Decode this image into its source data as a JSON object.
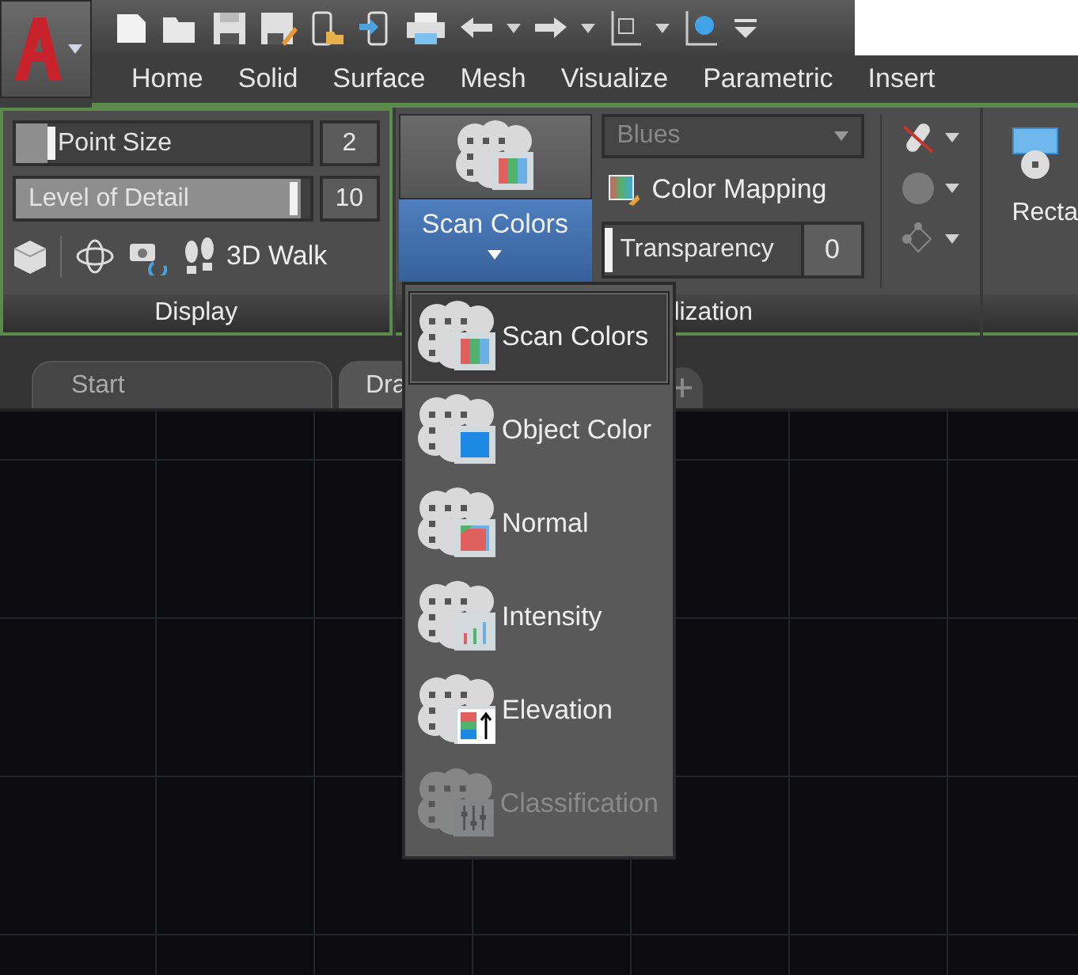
{
  "ribbon_tabs": [
    {
      "label": "Home",
      "selected": false
    },
    {
      "label": "Solid",
      "selected": false
    },
    {
      "label": "Surface",
      "selected": false
    },
    {
      "label": "Mesh",
      "selected": false
    },
    {
      "label": "Visualize",
      "selected": false
    },
    {
      "label": "Parametric",
      "selected": false
    },
    {
      "label": "Insert",
      "selected": false
    }
  ],
  "display_panel": {
    "title": "Display",
    "sliders": [
      {
        "label": "Point Size",
        "level": 0.11,
        "value": "2"
      },
      {
        "label": "Level of Detail",
        "level": 0.97,
        "value": "10"
      }
    ],
    "walk_button": {
      "label": "3D Walk"
    }
  },
  "visualization_panel": {
    "title": "lization",
    "scan_button": {
      "label": "Scan Colors"
    },
    "colormap_combo": {
      "value": "Blues",
      "disabled": true
    },
    "color_mapping_button": {
      "label": "Color Mapping"
    },
    "transparency": {
      "label": "Transparency",
      "level": 0,
      "value": "0"
    }
  },
  "next_panel": {
    "label": "Recta"
  },
  "document_tabs": [
    {
      "label": "Start",
      "selected": false
    },
    {
      "label": "Dra",
      "selected": true
    }
  ],
  "dropdown_menu": {
    "items": [
      {
        "kind": "scan",
        "label": "Scan Colors",
        "selected": true,
        "disabled": false
      },
      {
        "kind": "object",
        "label": "Object Color",
        "selected": false,
        "disabled": false
      },
      {
        "kind": "normal",
        "label": "Normal",
        "selected": false,
        "disabled": false
      },
      {
        "kind": "intensity",
        "label": "Intensity",
        "selected": false,
        "disabled": false
      },
      {
        "kind": "elevation",
        "label": "Elevation",
        "selected": false,
        "disabled": false
      },
      {
        "kind": "classification",
        "label": "Classification",
        "selected": false,
        "disabled": true
      }
    ]
  }
}
